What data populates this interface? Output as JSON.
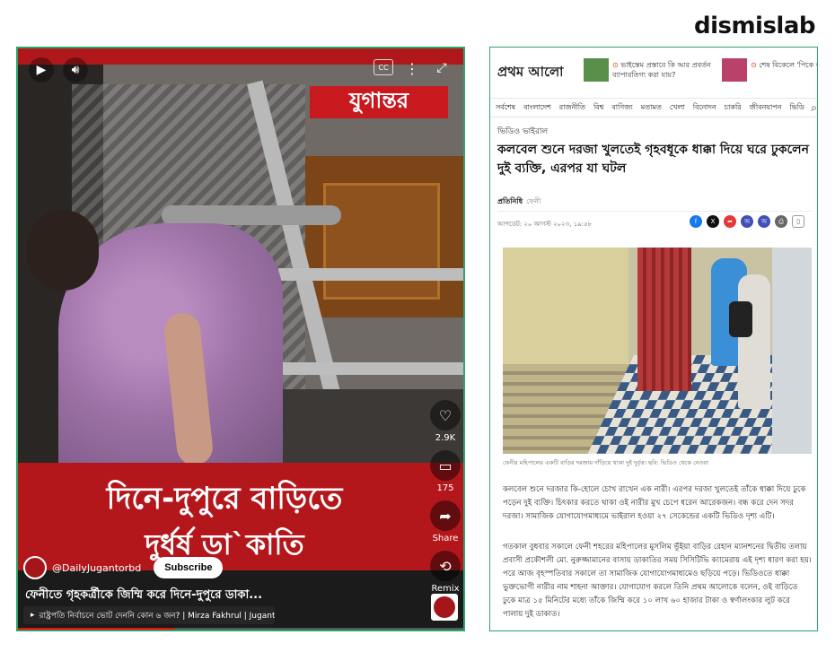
{
  "brand": "dismislab",
  "video": {
    "channel_logo_text": "যুগান্তর",
    "caption_line1": "দিনে-দুপুরে বাড়িতে",
    "caption_line2": "দুর্ধর্ষ ডা`কাতি",
    "likes": "2.9K",
    "comments": "175",
    "share_label": "Share",
    "remix_label": "Remix",
    "channel_handle": "@DailyJugantorbd",
    "subscribe_label": "Subscribe",
    "title": "ফেনীতে গৃহকর্ত্রীকে জিম্মি করে দিনে-দুপুরে ডাকা...",
    "related_text": "রাষ্ট্রপতি নির্বাচনে ভোট দেননি কোন ৬ জন? | Mirza Fakhrul | Jugantor",
    "progress": 0.35,
    "colors": {
      "caption_band": "#b3171c",
      "progress": "#ff0000"
    }
  },
  "article": {
    "logo": "প্রথম আলো",
    "teaser1": "ভাইস্তেম প্রস্তাবে কি আর প্রবর্তন ব্যাপারতিগ্য করা যায়?",
    "teaser2": "শেষ বিকেলে 'পিকে বা",
    "nav": [
      "সর্বশেষ",
      "বাংলাদেশ",
      "রাজনীতি",
      "বিশ্ব",
      "বাণিজ্য",
      "মতামত",
      "খেলা",
      "বিনোদন",
      "চাকরি",
      "জীবনযাপন",
      "ভিডি"
    ],
    "category": "ভিডিও ভাইরাল",
    "headline": "কলবেল শুনে দরজা খুলতেই গৃহবধূকে ধাক্কা দিয়ে ঘরে ঢুকলেন দুই ব্যক্তি, এরপর যা ঘটল",
    "byline": "প্রতিনিধি",
    "byline_place": "ফেনী",
    "date": "আপডেট: ২০ আগস্ট ২০২৩, ১৯:৫৮",
    "photo_caption": "ফেনীর মহিপালের একটি বাড়ির দরজায় দাঁড়িয়ে থাকা দুই দুর্বৃত্ত। ছবি: ভিডিও থেকে নেওয়া",
    "para1": "কলবেল শুনে দরজার কি-হোলে চোখ রাখেন এক নারী। এরপর দরজা খুলতেই তাঁকে ধাক্কা দিয়ে ঢুকে পড়েন দুই ব্যক্তি। চিৎকার করতে থাকা ওই নারীর মুখ চেপে ধরেন আরেকজন। বন্ধ করে দেন সদর দরজা। সামাজিক যোগাযোগমাধ্যমে ভাইরাল হওয়া ২৭ সেকেন্ডের একটি ভিডিও দৃশ্য এটি।",
    "para2": "গতকাল বুধবার সকালে ফেনী শহরের মহিপালের মুসলিম ভূঁইয়া বাড়ির রেহান ম্যানশনের দ্বিতীয় তলায় প্রবাসী প্রকৌশলী মো. নুরুজ্জামানের বাসায় ডাকাতির সময় সিসিটিভি ক্যামেরায় এই দৃশ্য ধারণ করা হয়। পরে আজ বৃহস্পতিবার সকালে তা সামাজিক যোগাযোগমাধ্যমেও ছড়িয়ে পড়ে। ভিডিওতে ধাক্কা ভুক্তভোগী নারীর নাম শাহনা আক্তার। যোগাযোগ করলে তিনি প্রথম আলোকে বলেন, ওই বাড়িতে ঢুকে মাত্র ১৫ মিনিটের মধ্যে তাঁকে জিম্মি করে ১০ লাখ ৬০ হাজার টাকা ও স্বর্ণালংকার লুট করে পালায় দুই ডাকাত।"
  }
}
